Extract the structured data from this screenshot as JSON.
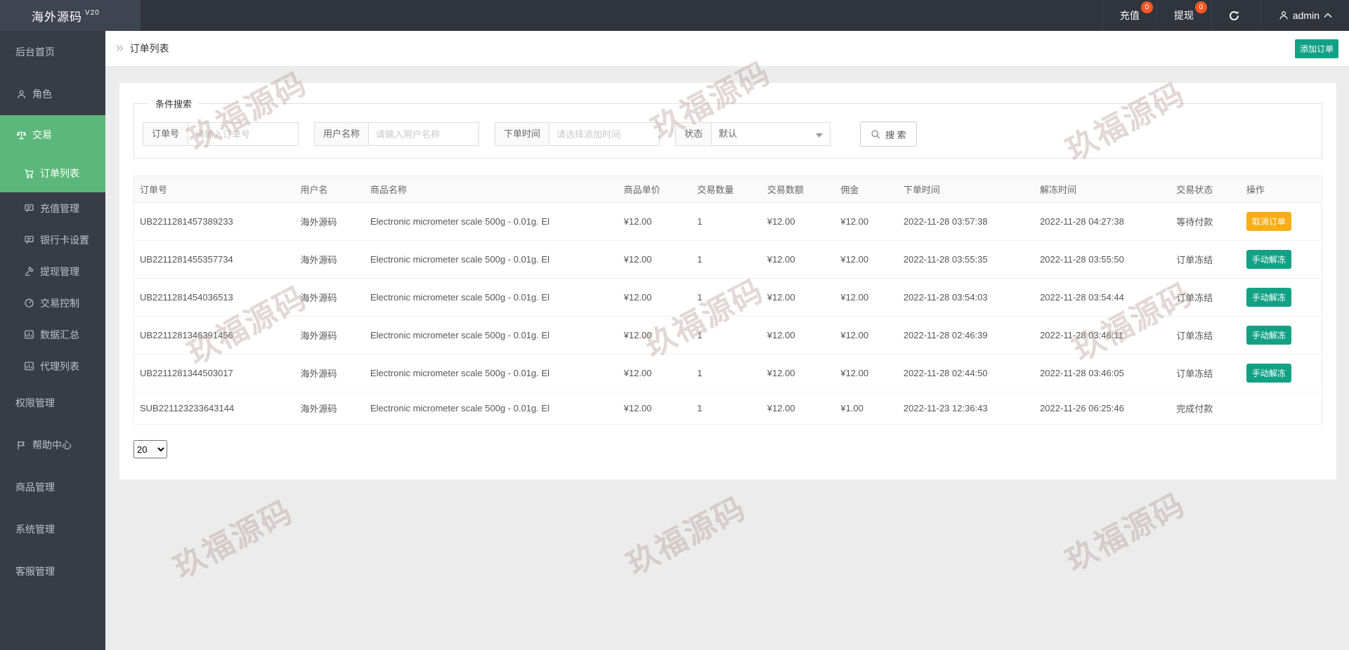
{
  "topbar": {
    "logo": "海外源码",
    "version": "V20",
    "nav": [
      {
        "id": "recharge",
        "label": "充值",
        "badge": "0"
      },
      {
        "id": "withdraw",
        "label": "提现",
        "badge": "0"
      }
    ],
    "username": "admin"
  },
  "sidebar": {
    "items": [
      {
        "id": "home",
        "label": "后台首页",
        "icon": null,
        "level": "top",
        "active": false
      },
      {
        "id": "role",
        "label": "角色",
        "icon": "user",
        "level": "top",
        "active": false
      },
      {
        "id": "trade",
        "label": "交易",
        "icon": "scales",
        "level": "top",
        "active": true
      },
      {
        "id": "order-list",
        "label": "订单列表",
        "icon": "cart",
        "level": "sub",
        "active": true
      },
      {
        "id": "recharge-manage",
        "label": "充值管理",
        "icon": "board",
        "level": "sub",
        "active": false
      },
      {
        "id": "bank-card",
        "label": "银行卡设置",
        "icon": "board",
        "level": "sub",
        "active": false
      },
      {
        "id": "withdraw-manage",
        "label": "提现管理",
        "icon": "gavel",
        "level": "sub",
        "active": false
      },
      {
        "id": "trade-control",
        "label": "交易控制",
        "icon": "gauge",
        "level": "sub",
        "active": false
      },
      {
        "id": "data-summary",
        "label": "数据汇总",
        "icon": "chart",
        "level": "sub",
        "active": false
      },
      {
        "id": "agent-list",
        "label": "代理列表",
        "icon": "chart",
        "level": "sub",
        "active": false
      },
      {
        "id": "permission",
        "label": "权限管理",
        "icon": null,
        "level": "top",
        "active": false
      },
      {
        "id": "help-center",
        "label": "帮助中心",
        "icon": "flag",
        "level": "top",
        "active": false
      },
      {
        "id": "product-manage",
        "label": "商品管理",
        "icon": null,
        "level": "top",
        "active": false
      },
      {
        "id": "system-manage",
        "label": "系统管理",
        "icon": null,
        "level": "top",
        "active": false
      },
      {
        "id": "service-manage",
        "label": "客服管理",
        "icon": null,
        "level": "top",
        "active": false
      }
    ]
  },
  "breadcrumb": {
    "arrow": "»",
    "title": "订单列表",
    "add_button": "添加订单"
  },
  "search": {
    "legend": "条件搜索",
    "fields": [
      {
        "id": "order-no",
        "label": "订单号",
        "placeholder": "请输入订单号"
      },
      {
        "id": "user-name",
        "label": "用户名称",
        "placeholder": "请输入用户名称"
      },
      {
        "id": "order-time",
        "label": "下单时间",
        "placeholder": "请选择添加时间"
      }
    ],
    "status": {
      "label": "状态",
      "value": "默认"
    },
    "button": "搜 索"
  },
  "table": {
    "headers": [
      "订单号",
      "用户名",
      "商品名称",
      "商品单价",
      "交易数量",
      "交易数额",
      "佣金",
      "下单时间",
      "解冻时间",
      "交易状态",
      "操作"
    ],
    "rows": [
      {
        "order_no": "UB2211281457389233",
        "user": "海外源码",
        "product": "Electronic micrometer scale 500g - 0.01g. El",
        "price": "¥12.00",
        "qty": "1",
        "amount": "¥12.00",
        "commission": "¥12.00",
        "order_time": "2022-11-28 03:57:38",
        "unfreeze_time": "2022-11-28 04:27:38",
        "status": "等待付款",
        "action": {
          "label": "取消订单",
          "type": "warning"
        }
      },
      {
        "order_no": "UB2211281455357734",
        "user": "海外源码",
        "product": "Electronic micrometer scale 500g - 0.01g. El",
        "price": "¥12.00",
        "qty": "1",
        "amount": "¥12.00",
        "commission": "¥12.00",
        "order_time": "2022-11-28 03:55:35",
        "unfreeze_time": "2022-11-28 03:55:50",
        "status": "订单冻结",
        "action": {
          "label": "手动解冻",
          "type": "teal"
        }
      },
      {
        "order_no": "UB2211281454036513",
        "user": "海外源码",
        "product": "Electronic micrometer scale 500g - 0.01g. El",
        "price": "¥12.00",
        "qty": "1",
        "amount": "¥12.00",
        "commission": "¥12.00",
        "order_time": "2022-11-28 03:54:03",
        "unfreeze_time": "2022-11-28 03:54:44",
        "status": "订单冻结",
        "action": {
          "label": "手动解冻",
          "type": "teal"
        }
      },
      {
        "order_no": "UB2211281346391456",
        "user": "海外源码",
        "product": "Electronic micrometer scale 500g - 0.01g. El",
        "price": "¥12.00",
        "qty": "1",
        "amount": "¥12.00",
        "commission": "¥12.00",
        "order_time": "2022-11-28 02:46:39",
        "unfreeze_time": "2022-11-28 03:46:11",
        "status": "订单冻结",
        "action": {
          "label": "手动解冻",
          "type": "teal"
        }
      },
      {
        "order_no": "UB2211281344503017",
        "user": "海外源码",
        "product": "Electronic micrometer scale 500g - 0.01g. El",
        "price": "¥12.00",
        "qty": "1",
        "amount": "¥12.00",
        "commission": "¥12.00",
        "order_time": "2022-11-28 02:44:50",
        "unfreeze_time": "2022-11-28 03:46:05",
        "status": "订单冻结",
        "action": {
          "label": "手动解冻",
          "type": "teal"
        }
      },
      {
        "order_no": "SUB221123233643144",
        "user": "海外源码",
        "product": "Electronic micrometer scale 500g - 0.01g. El",
        "price": "¥12.00",
        "qty": "1",
        "amount": "¥12.00",
        "commission": "¥1.00",
        "order_time": "2022-11-23 12:36:43",
        "unfreeze_time": "2022-11-26 06:25:46",
        "status": "完成付款",
        "action": null
      }
    ]
  },
  "pagination": {
    "page_size": "20"
  },
  "watermark": {
    "text": "玖福源码"
  },
  "colors": {
    "topbar": "#30343d",
    "logo_block": "#3e4450",
    "sidebar": "#373c47",
    "sidebar_active": "#5cb87a",
    "teal_button": "#13a185",
    "warning_button": "#f8ae14",
    "badge": "#ff5722",
    "content_bg": "#ececec"
  }
}
